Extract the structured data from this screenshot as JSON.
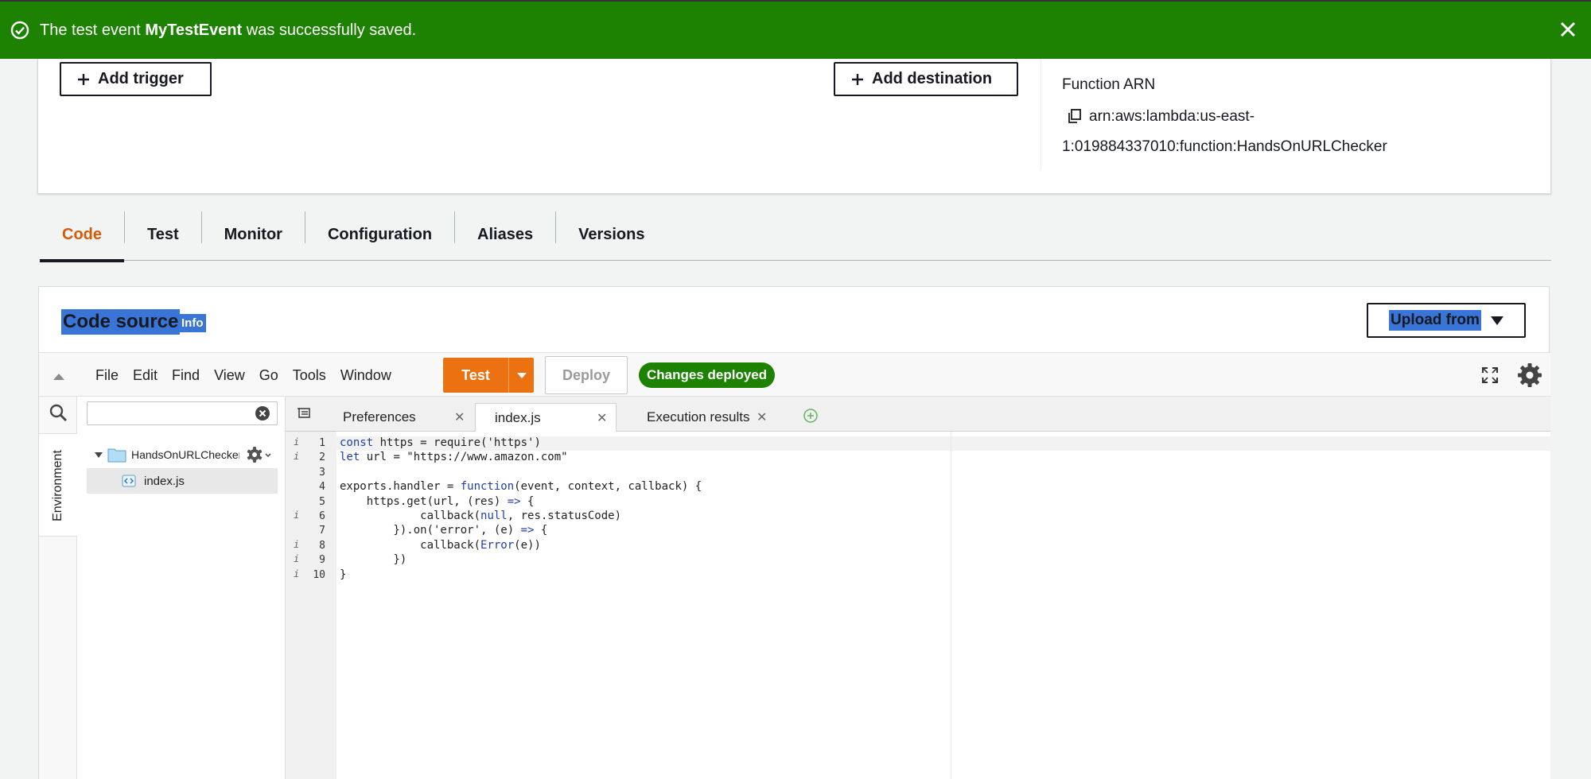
{
  "flash": {
    "message_prefix": "The test event",
    "event_name": "MyTestEvent",
    "message_suffix": "was successfully saved.",
    "color": "#1d8102"
  },
  "overview": {
    "add_trigger_label": "Add trigger",
    "add_destination_label": "Add destination",
    "arn_title": "Function ARN",
    "arn_line1": "arn:aws:lambda:us-east-",
    "arn_line2": "1:019884337010:function:HandsOnURLChecker"
  },
  "tabs": [
    {
      "label": "Code",
      "active": true
    },
    {
      "label": "Test",
      "active": false
    },
    {
      "label": "Monitor",
      "active": false
    },
    {
      "label": "Configuration",
      "active": false
    },
    {
      "label": "Aliases",
      "active": false
    },
    {
      "label": "Versions",
      "active": false
    }
  ],
  "code_source": {
    "title": "Code source",
    "info_label": "Info",
    "upload_label": "Upload from"
  },
  "ide": {
    "menu": [
      "File",
      "Edit",
      "Find",
      "View",
      "Go",
      "Tools",
      "Window"
    ],
    "test_label": "Test",
    "deploy_label": "Deploy",
    "status_badge": "Changes deployed",
    "environment_label": "Environment",
    "search_value": "",
    "folder_name": "HandsOnURLChecker",
    "file_name": "index.js",
    "editor_tabs": [
      {
        "label": "Preferences",
        "active": false
      },
      {
        "label": "index.js",
        "active": true
      },
      {
        "label": "Execution results",
        "active": false
      }
    ],
    "code_lines": [
      {
        "num": "1",
        "warn": true,
        "text": "const https = require('https')"
      },
      {
        "num": "2",
        "warn": true,
        "text": "let url = \"https://www.amazon.com\""
      },
      {
        "num": "3",
        "warn": false,
        "text": ""
      },
      {
        "num": "4",
        "warn": false,
        "text": "exports.handler = function(event, context, callback) {"
      },
      {
        "num": "5",
        "warn": false,
        "text": "    https.get(url, (res) => {"
      },
      {
        "num": "6",
        "warn": true,
        "text": "            callback(null, res.statusCode)"
      },
      {
        "num": "7",
        "warn": false,
        "text": "        }).on('error', (e) => {"
      },
      {
        "num": "8",
        "warn": true,
        "text": "            callback(Error(e))"
      },
      {
        "num": "9",
        "warn": true,
        "text": "        })"
      },
      {
        "num": "10",
        "warn": true,
        "text": "}"
      }
    ],
    "colors": {
      "test_button": "#ec7211",
      "badge": "#1d8102",
      "active_tab": "#d45b07"
    }
  }
}
